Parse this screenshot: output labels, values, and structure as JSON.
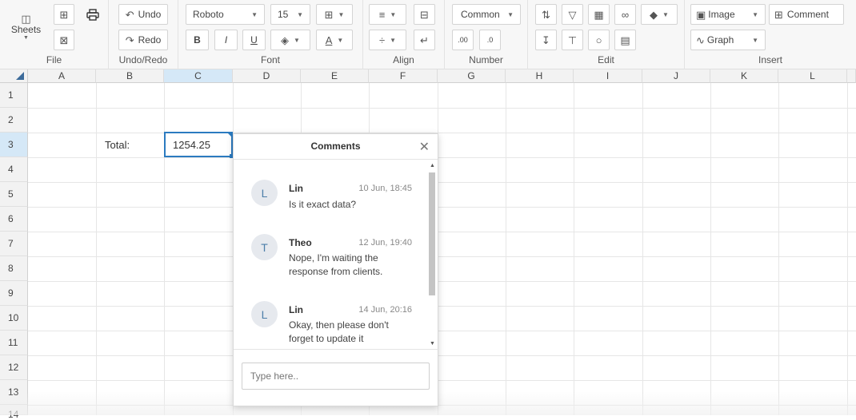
{
  "toolbar": {
    "file": {
      "label": "File",
      "sheets_label": "Sheets",
      "icons": [
        "sheets-icon",
        "import-icon",
        "print-icon",
        "export-icon"
      ]
    },
    "undo_redo": {
      "label": "Undo/Redo",
      "undo_label": "Undo",
      "redo_label": "Redo"
    },
    "font": {
      "label": "Font",
      "family": "Roboto",
      "size": "15",
      "bold": "B",
      "italic": "I",
      "underline": "U"
    },
    "align": {
      "label": "Align"
    },
    "number": {
      "label": "Number",
      "format": "Common",
      "dec_increase": ".00",
      "dec_decrease": ".0"
    },
    "edit": {
      "label": "Edit"
    },
    "insert": {
      "label": "Insert",
      "image_label": "Image",
      "comment_label": "Comment",
      "graph_label": "Graph"
    }
  },
  "grid": {
    "columns": [
      "A",
      "B",
      "C",
      "D",
      "E",
      "F",
      "G",
      "H",
      "I",
      "J",
      "K",
      "L"
    ],
    "selected_column": "C",
    "rows": [
      "1",
      "2",
      "3",
      "4",
      "5",
      "6",
      "7",
      "8",
      "9",
      "10",
      "11",
      "12",
      "13",
      "14"
    ],
    "selected_row": "3",
    "cells": {
      "B3": "Total:",
      "C3": "1254.25"
    }
  },
  "comments_panel": {
    "title": "Comments",
    "comments": [
      {
        "initial": "L",
        "author": "Lin",
        "time": "10 Jun, 18:45",
        "text": "Is it exact data?"
      },
      {
        "initial": "T",
        "author": "Theo",
        "time": "12 Jun, 19:40",
        "text": "Nope, I'm waiting the response from clients."
      },
      {
        "initial": "L",
        "author": "Lin",
        "time": "14 Jun, 20:16",
        "text": "Okay, then please don't forget to update it"
      }
    ],
    "input_placeholder": "Type here.."
  },
  "colors": {
    "accent": "#2b7bc0",
    "selected_header": "#d5e8f7",
    "toolbar_bg": "#f7f7f7"
  }
}
